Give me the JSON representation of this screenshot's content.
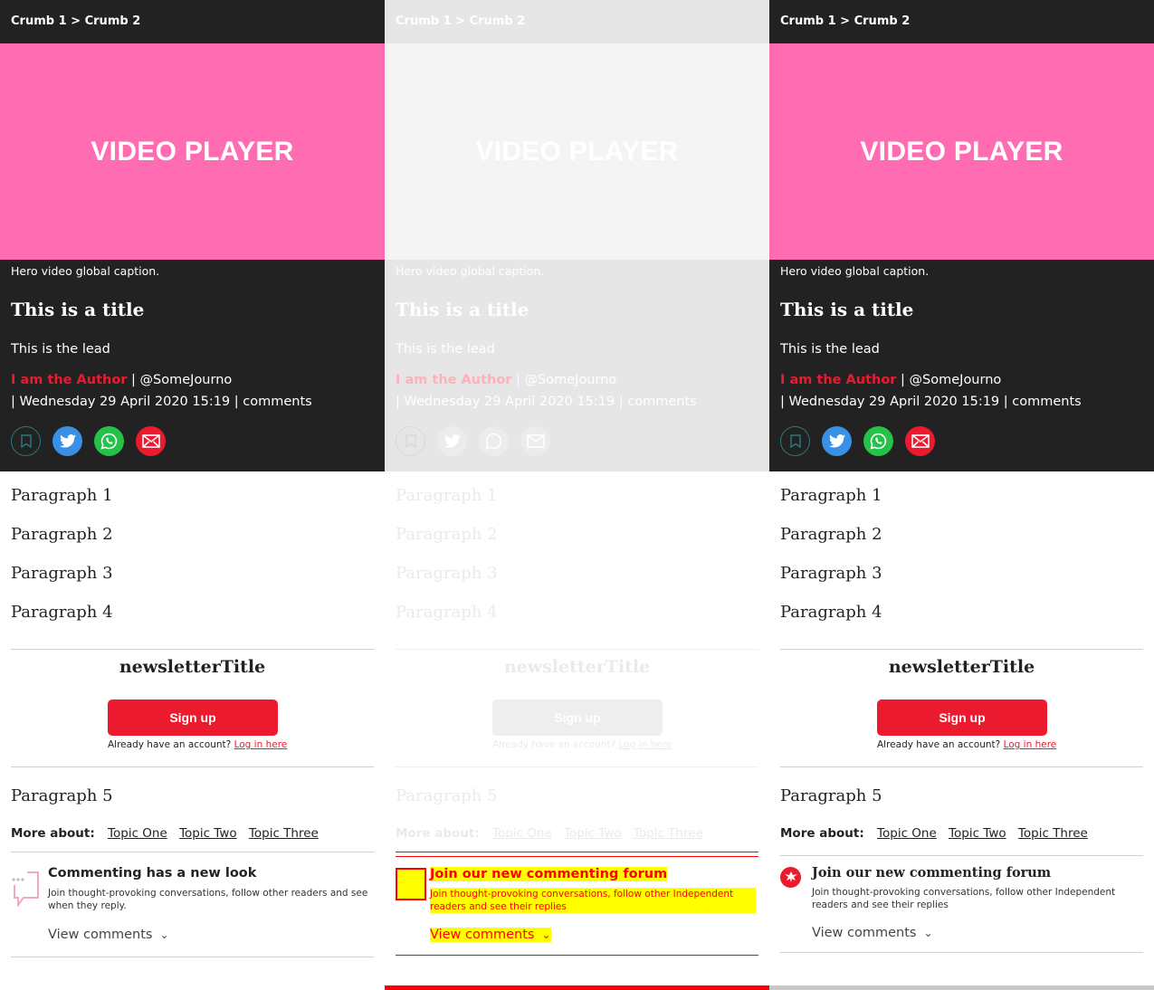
{
  "breadcrumb": {
    "crumb1": "Crumb 1",
    "sep": ">",
    "crumb2": "Crumb 2"
  },
  "video": {
    "label": "VIDEO PLAYER"
  },
  "hero": {
    "caption": "Hero video global caption.",
    "title": "This is a title",
    "lead": "This is the lead",
    "author": "I am the Author",
    "handle": "| @SomeJourno",
    "dateline": "| Wednesday 29 April 2020 15:19 |  comments"
  },
  "share_icons": [
    "bookmark-icon",
    "twitter-icon",
    "whatsapp-icon",
    "email-icon"
  ],
  "paragraphs": [
    "Paragraph 1",
    "Paragraph 2",
    "Paragraph 3",
    "Paragraph 4"
  ],
  "newsletter": {
    "title": "newsletterTitle",
    "signup_label": "Sign up",
    "already_text": "Already have an account?",
    "login_link": "Log in here"
  },
  "paragraph5": "Paragraph 5",
  "more_about": {
    "label": "More about:",
    "topics": [
      "Topic One",
      "Topic Two",
      "Topic Three"
    ]
  },
  "comments_old": {
    "title": "Commenting has a new look",
    "desc": "Join thought-provoking conversations, follow other readers and see when they reply.",
    "view": "View comments"
  },
  "comments_new": {
    "title": "Join our new commenting forum",
    "desc": "Join thought-provoking conversations, follow other Independent readers and see their replies",
    "view": "View comments"
  },
  "colors": {
    "brand_red": "#ec1a2e",
    "video_pink": "#ff6cb1",
    "dark_bg": "#222222",
    "diff_red": "#ff0000",
    "diff_yellow": "#ffff00"
  }
}
